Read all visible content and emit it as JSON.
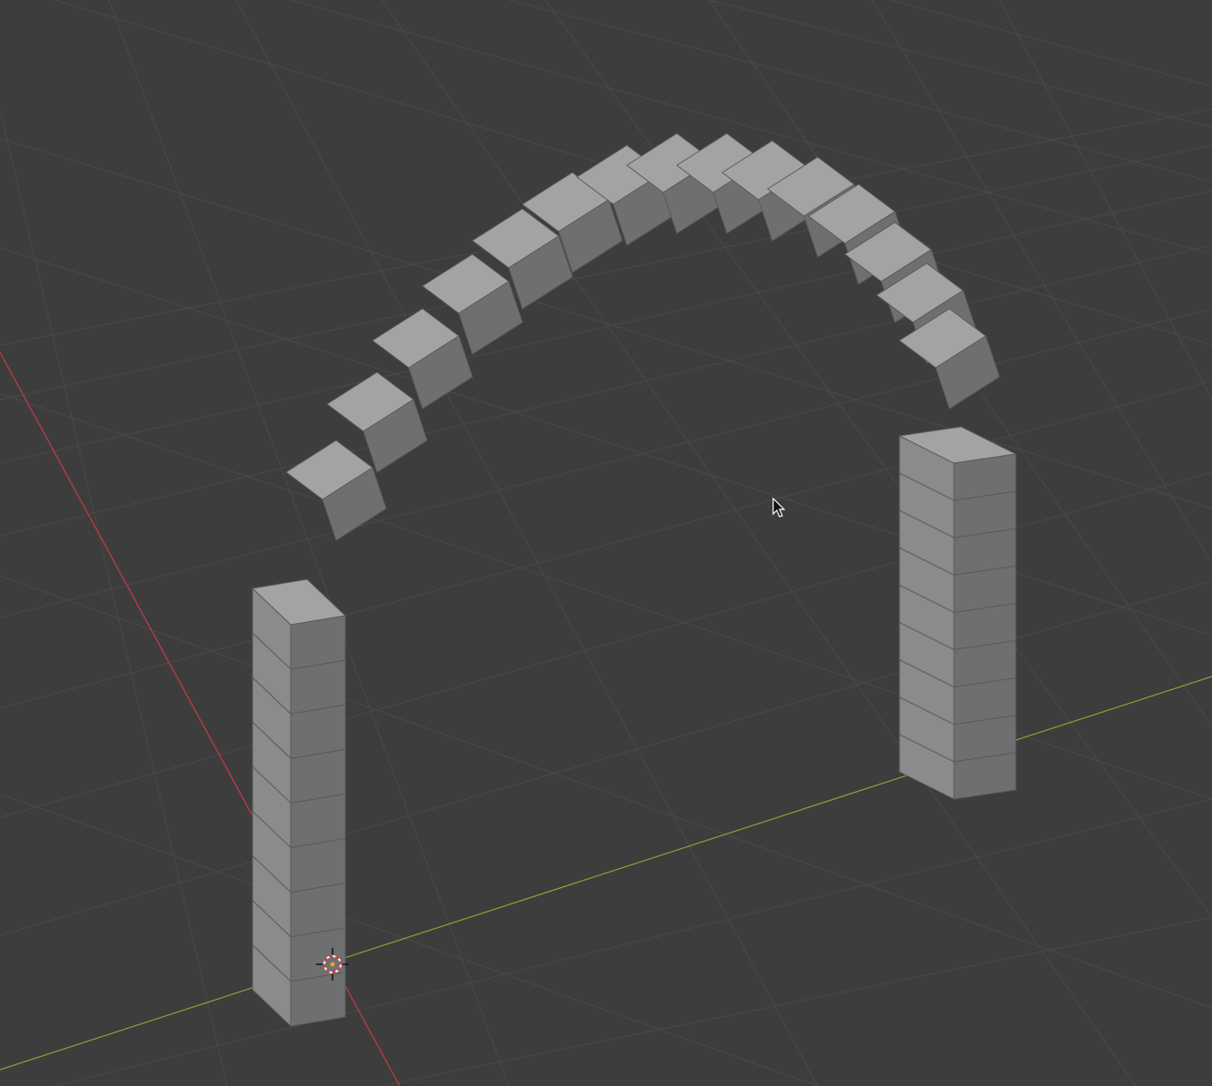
{
  "viewport": {
    "background": "#3d3d3d",
    "grid_color": "#4a4a4a",
    "x_axis_color": "#c83a44",
    "y_axis_color": "#7fa83a"
  },
  "scene": {
    "object_color_light": "#a2a3a4",
    "object_color_mid": "#8a8b8c",
    "object_color_dark": "#6e6f70",
    "cursor_icon": "mouse-pointer-icon",
    "origin_icon": "3d-cursor-icon"
  }
}
